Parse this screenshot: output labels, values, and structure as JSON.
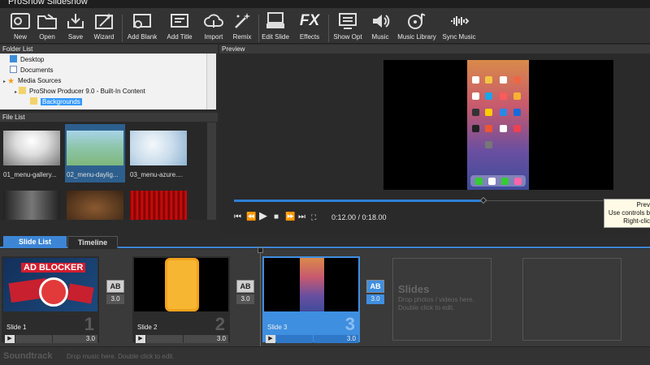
{
  "window": {
    "title": "ProShow Slideshow"
  },
  "toolbar": {
    "items": [
      {
        "label": "New",
        "icon": "new-slideshow-icon"
      },
      {
        "label": "Open",
        "icon": "folder-open-icon"
      },
      {
        "label": "Save",
        "icon": "save-icon"
      },
      {
        "label": "Wizard",
        "icon": "wizard-icon"
      },
      {
        "label": "Add Blank",
        "icon": "add-blank-icon"
      },
      {
        "label": "Add Title",
        "icon": "add-title-icon"
      },
      {
        "label": "Import",
        "icon": "import-cloud-icon"
      },
      {
        "label": "Remix",
        "icon": "remix-wand-icon"
      },
      {
        "label": "Edit Slide",
        "icon": "edit-slide-icon"
      },
      {
        "label": "Effects",
        "icon": "fx-icon"
      },
      {
        "label": "Show Opt",
        "icon": "show-options-icon"
      },
      {
        "label": "Music",
        "icon": "speaker-icon"
      },
      {
        "label": "Music Library",
        "icon": "music-library-icon"
      },
      {
        "label": "Sync Music",
        "icon": "sync-music-icon"
      }
    ],
    "fx_text": "FX"
  },
  "folder_list": {
    "title": "Folder List",
    "items": [
      {
        "label": "Desktop"
      },
      {
        "label": "Documents"
      },
      {
        "label": "Media Sources"
      },
      {
        "label": "ProShow Producer 9.0 - Built-In Content"
      },
      {
        "label": "Backgrounds"
      }
    ]
  },
  "file_list": {
    "title": "File List",
    "files": [
      {
        "label": "01_menu-gallery..."
      },
      {
        "label": "02_menu-daylig..."
      },
      {
        "label": "03_menu-azure...."
      },
      {
        "label": ""
      },
      {
        "label": ""
      },
      {
        "label": ""
      }
    ]
  },
  "preview": {
    "title": "Preview",
    "timecode": "0:12.00 / 0:18.00",
    "progress_fraction": 0.667,
    "tooltip_lines": [
      "Prev",
      "Use controls b",
      "Right-clic"
    ]
  },
  "tabs": [
    {
      "label": "Slide List",
      "active": true
    },
    {
      "label": "Timeline",
      "active": false
    }
  ],
  "slides": [
    {
      "name": "Slide 1",
      "number": "1",
      "duration": "3.0",
      "image": "ad-blocker"
    },
    {
      "name": "Slide 2",
      "number": "2",
      "duration": "3.0",
      "image": "apple-phone"
    },
    {
      "name": "Slide 3",
      "number": "3",
      "duration": "3.0",
      "image": "iphone-homescreen"
    }
  ],
  "transitions": [
    {
      "label": "AB",
      "duration": "3.0"
    },
    {
      "label": "AB",
      "duration": "3.0"
    },
    {
      "label": "AB",
      "duration": "3.0"
    }
  ],
  "slide_1_image_text": "AD BLOCKER",
  "placeholder": {
    "title": "Slides",
    "hint": "Drop photos / videos here. Double click to edit."
  },
  "soundtrack": {
    "label": "Soundtrack",
    "hint": "Drop music here.  Double click to edit."
  },
  "colors": {
    "accent": "#3f8fe0",
    "panel": "#2b2b2b"
  }
}
